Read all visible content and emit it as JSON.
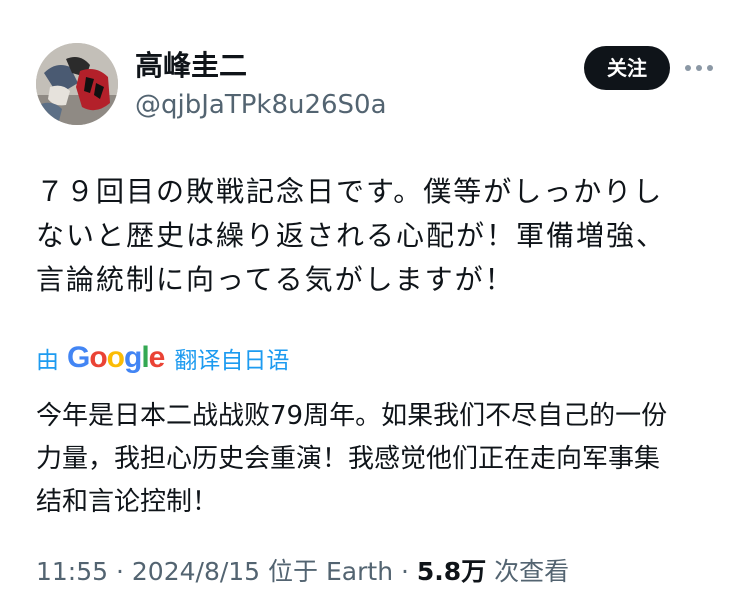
{
  "author": {
    "display_name": "高峰圭二",
    "handle": "@qjbJaTPk8u26S0a"
  },
  "follow_button": {
    "label": "关注"
  },
  "tweet": {
    "text": "７９回目の敗戦記念日です。僕等がしっかりし\nないと歴史は繰り返される心配が！軍備増強、\n言論統制に向ってる気がしますが！"
  },
  "translation": {
    "by_label": "由",
    "provider_letters": [
      "G",
      "o",
      "o",
      "g",
      "l",
      "e"
    ],
    "action_label": "翻译自日语",
    "text": "今年是日本二战战败79周年。如果我们不尽自己的一份\n力量，我担心历史会重演！我感觉他们正在走向军事集\n结和言论控制！"
  },
  "meta": {
    "time": "11:55",
    "separator": "·",
    "date": "2024/8/15",
    "location": "位于 Earth",
    "views_count": "5.8万",
    "views_label": "次查看"
  },
  "colors": {
    "accent": "#1d9bf0",
    "text_primary": "#0f1419",
    "text_secondary": "#536471",
    "follow_bg": "#0f1419"
  },
  "icons": {
    "more": "more-horizontal-icon"
  }
}
